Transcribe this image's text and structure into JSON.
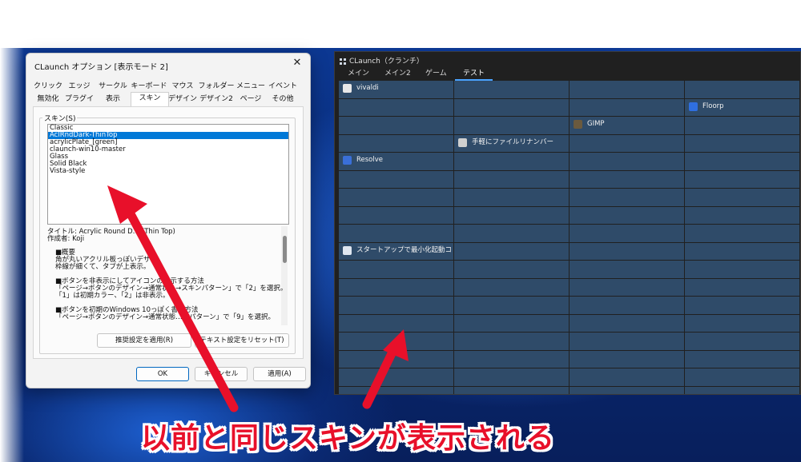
{
  "dialog": {
    "title": "CLaunch オプション [表示モード 2]",
    "close_glyph": "✕",
    "tabs_row1": [
      "クリック",
      "エッジ",
      "サークル",
      "キーボード",
      "マウス",
      "フォルダー",
      "メニュー",
      "イベント"
    ],
    "tabs_row2": [
      "無効化",
      "プラグイン",
      "表示",
      "スキン",
      "デザイン1",
      "デザイン2",
      "ページ",
      "その他"
    ],
    "active_tab": "スキン",
    "group_label": "スキン(S)",
    "skins": [
      "Classic",
      "AclRndDark-ThinTop",
      "acrylicPlate_[green]",
      "claunch-win10-master",
      "Glass",
      "Solid Black",
      "Vista-style"
    ],
    "selected_skin": "AclRndDark-ThinTop",
    "description": [
      "タイトル: Acrylic Round D… (Thin Top)",
      "作成者: Koji",
      "■概要",
      "角が丸いアクリル板っぽいデザ…",
      "枠線が細くて、タブが上表示。",
      "■ボタンを非表示にしてアイコンの…示する方法",
      "「ページ→ボタンのデザイン→通常状…→スキンパターン」で「2」を選択。",
      "「1」は初期カラー、「2」は非表示。",
      "■ボタンを初期のWindows 10っぽく書く方法",
      "「ページ→ボタンのデザイン→通常状態…ンパターン」で「9」を選択。"
    ],
    "apply_recommended_label": "推奨設定を適用(R)",
    "reset_text_label": "テキスト設定をリセット(T)",
    "ok_label": "OK",
    "cancel_label": "キャンセル",
    "apply_label": "適用(A)"
  },
  "launcher": {
    "title": "CLaunch（クランチ）",
    "tabs": [
      "メイン",
      "メイン2",
      "ゲーム",
      "テスト"
    ],
    "active_tab": "テスト",
    "items": [
      {
        "label": "vivaldi",
        "icon": "file-icon",
        "color": "#e8e8e8",
        "row": 0,
        "col": 0
      },
      {
        "label": "Floorp",
        "icon": "floorp-icon",
        "color": "#2f6fe0",
        "row": 1,
        "col": 3
      },
      {
        "label": "GIMP",
        "icon": "gimp-icon",
        "color": "#6b5a3e",
        "row": 2,
        "col": 2
      },
      {
        "label": "手軽にファイルリナンバー",
        "icon": "renamer-icon",
        "color": "#cfcfcf",
        "row": 3,
        "col": 1
      },
      {
        "label": "Resolve",
        "icon": "resolve-icon",
        "color": "#3a6fd8",
        "row": 4,
        "col": 0
      },
      {
        "label": "スタートアップで最小化起動コ",
        "icon": "startup-icon",
        "color": "#dfe6f0",
        "row": 9,
        "col": 0
      }
    ]
  },
  "caption": "以前と同じスキンが表示される",
  "colors": {
    "accent": "#0078d7",
    "cell": "#2f4b69",
    "arrow": "#e8102a"
  }
}
